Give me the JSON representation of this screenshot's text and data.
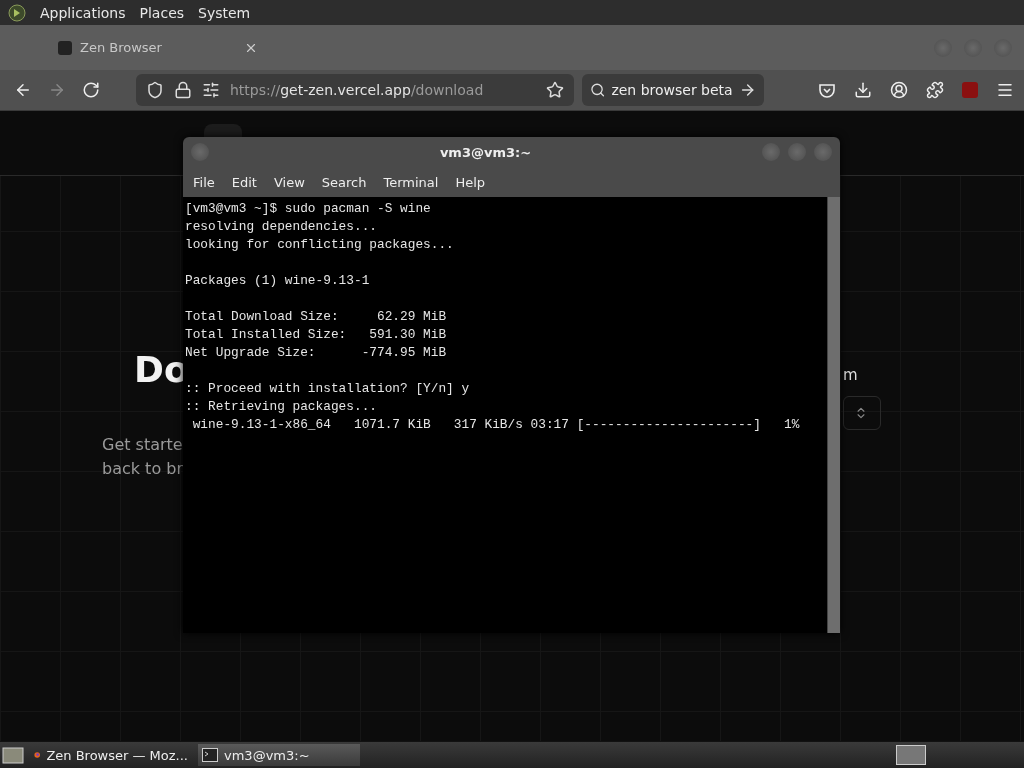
{
  "top_panel": {
    "menus": [
      "Applications",
      "Places",
      "System"
    ]
  },
  "browser": {
    "tab": {
      "title": "Zen Browser",
      "selected": true
    },
    "url": {
      "scheme": "https://",
      "host": "get-zen.vercel.app",
      "path": "/download"
    },
    "search": {
      "value": "zen browser beta"
    }
  },
  "page": {
    "heading": "Do",
    "lines": [
      "Get starte",
      "back to br"
    ],
    "side_label": "m"
  },
  "terminal": {
    "title": "vm3@vm3:~",
    "menus": [
      "File",
      "Edit",
      "View",
      "Search",
      "Terminal",
      "Help"
    ],
    "blocks": [
      [
        "[vm3@vm3 ~]$ sudo pacman -S wine",
        "resolving dependencies...",
        "looking for conflicting packages..."
      ],
      [
        "Packages (1) wine-9.13-1"
      ],
      [
        "Total Download Size:     62.29 MiB",
        "Total Installed Size:   591.30 MiB",
        "Net Upgrade Size:      -774.95 MiB"
      ],
      [
        ":: Proceed with installation? [Y/n] y",
        ":: Retrieving packages...",
        " wine-9.13-1-x86_64   1071.7 KiB   317 KiB/s 03:17 [----------------------]   1%"
      ]
    ]
  },
  "taskbar": {
    "items": [
      {
        "kind": "browser",
        "label": "Zen Browser — Moz...",
        "selected": false
      },
      {
        "kind": "terminal",
        "label": "vm3@vm3:~",
        "selected": true
      }
    ]
  }
}
